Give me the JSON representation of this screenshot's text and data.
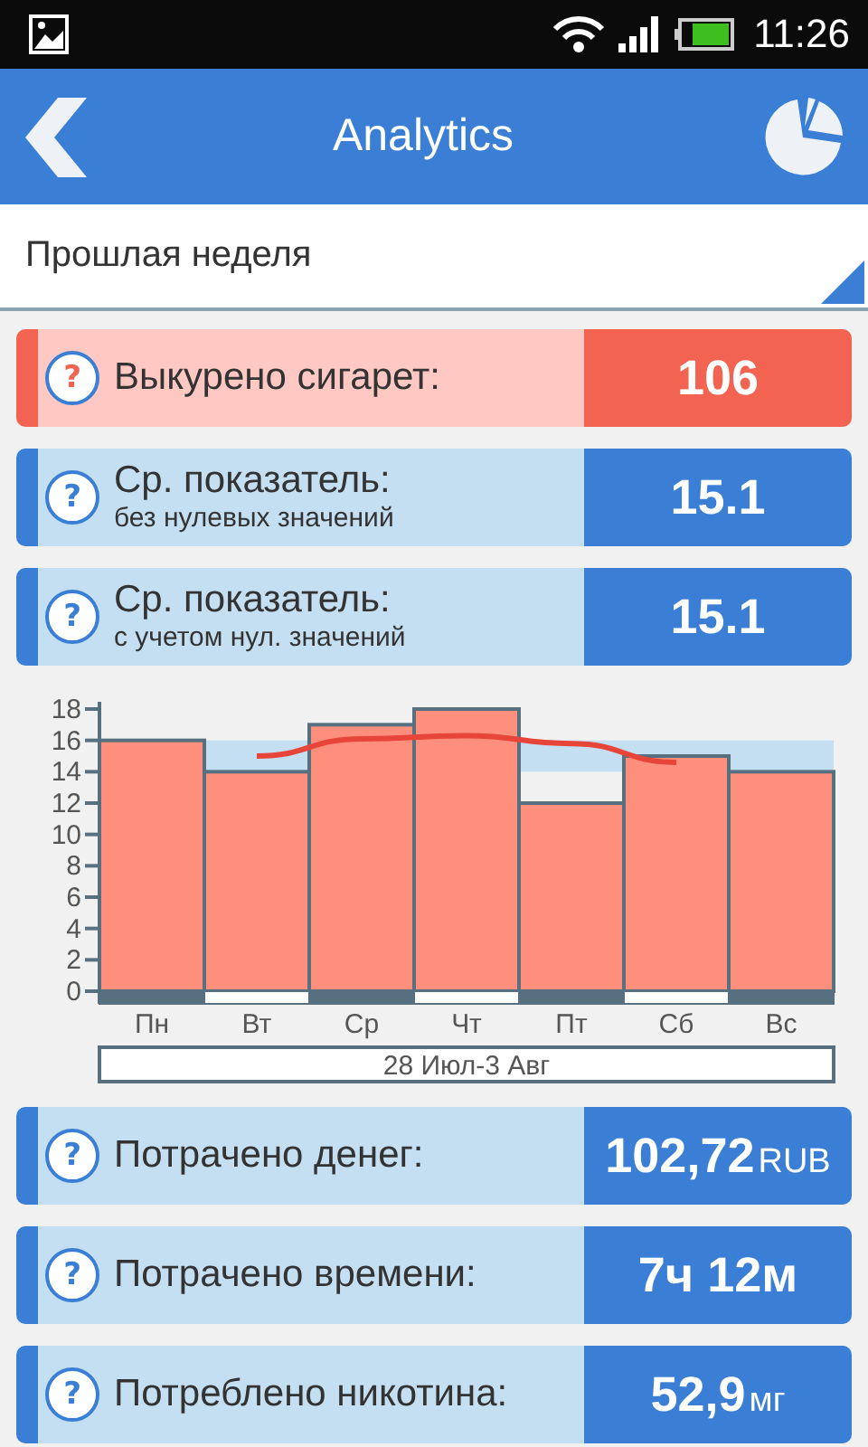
{
  "status_bar": {
    "time": "11:26"
  },
  "header": {
    "title": "Analytics"
  },
  "period_select": {
    "value": "Прошлая неделя"
  },
  "stats_top": [
    {
      "help": "?",
      "label": "Выкурено сигарет:",
      "value": "106",
      "color": "#f26451"
    },
    {
      "help": "?",
      "label": "Ср. показатель:",
      "sublabel": "без нулевых значений",
      "value": "15.1",
      "color": "#3a7fd5"
    },
    {
      "help": "?",
      "label": "Ср. показатель:",
      "sublabel": "с учетом нул. значений",
      "value": "15.1",
      "color": "#3a7fd5"
    }
  ],
  "chart": {
    "chart_data": {
      "type": "bar",
      "xlabel": "28 Июл-3 Авг",
      "categories": [
        "Пн",
        "Вт",
        "Ср",
        "Чт",
        "Пт",
        "Сб",
        "Вс"
      ],
      "values": [
        16,
        14,
        17,
        18,
        12,
        15,
        14
      ],
      "ylim": [
        0,
        18
      ],
      "yticks": [
        0,
        2,
        4,
        6,
        8,
        10,
        12,
        14,
        16,
        18
      ],
      "bands": [
        {
          "axis": "y",
          "from": 14,
          "to": 16,
          "color": "#c5dff2"
        }
      ],
      "series": [
        {
          "type": "line",
          "color": "#e8453a",
          "values": [
            null,
            15,
            16.1,
            16.3,
            15.8,
            14.6,
            null
          ]
        }
      ]
    }
  },
  "stats_bottom": [
    {
      "help": "?",
      "label": "Потрачено денег:",
      "value": "102,72",
      "unit": "RUB",
      "color": "#3a7fd5"
    },
    {
      "help": "?",
      "label": "Потрачено времени:",
      "value": "7ч 12м",
      "color": "#3a7fd5"
    },
    {
      "help": "?",
      "label": "Потреблено никотина:",
      "value": "52,9",
      "unit": "мг",
      "color": "#3a7fd5"
    }
  ]
}
